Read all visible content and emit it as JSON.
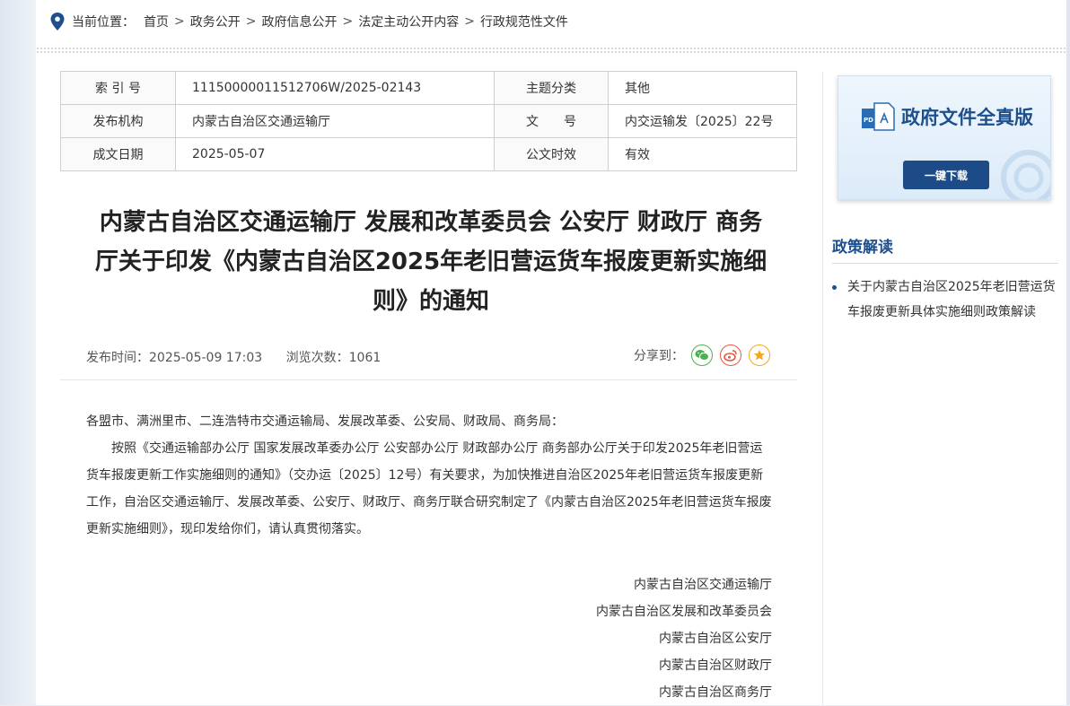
{
  "breadcrumb": {
    "prefix": "当前位置：",
    "items": [
      "首页",
      "政务公开",
      "政府信息公开",
      "法定主动公开内容",
      "行政规范性文件"
    ],
    "separator": ">"
  },
  "meta": {
    "index_label": "索 引 号",
    "index_value": "11150000011512706W/2025-02143",
    "topic_label": "主题分类",
    "topic_value": "其他",
    "org_label": "发布机构",
    "org_value": "内蒙古自治区交通运输厅",
    "docno_label": "文　　号",
    "docno_value": "内交运输发〔2025〕22号",
    "date_label": "成文日期",
    "date_value": "2025-05-07",
    "validity_label": "公文时效",
    "validity_value": "有效"
  },
  "title": {
    "line1": "内蒙古自治区交通运输厅 发展和改革委员会 公安厅 财政厅 商务",
    "line2": "厅关于印发《内蒙古自治区2025年老旧营运货车报废更新实施细",
    "line3": "则》的通知"
  },
  "pub": {
    "time": "发布时间：2025-05-09 17:03",
    "views": "浏览次数：1061",
    "share_label": "分享到："
  },
  "body": {
    "salutation": "各盟市、满洲里市、二连浩特市交通运输局、发展改革委、公安局、财政局、商务局：",
    "paragraph": "按照《交通运输部办公厅 国家发展改革委办公厅 公安部办公厅 财政部办公厅 商务部办公厅关于印发2025年老旧营运货车报废更新工作实施细则的通知》（交办运〔2025〕12号）有关要求，为加快推进自治区2025年老旧营运货车报废更新工作，自治区交通运输厅、发展改革委、公安厅、财政厅、商务厅联合研究制定了《内蒙古自治区2025年老旧营运货车报废更新实施细则》，现印发给你们，请认真贯彻落实。",
    "signatures": [
      "内蒙古自治区交通运输厅",
      "内蒙古自治区发展和改革委员会",
      "内蒙古自治区公安厅",
      "内蒙古自治区财政厅",
      "内蒙古自治区商务厅"
    ]
  },
  "sidebar": {
    "banner_title": "政府文件全真版",
    "banner_button": "一键下载",
    "section_title": "政策解读",
    "links": [
      "关于内蒙古自治区2025年老旧营运货车报废更新具体实施细则政策解读"
    ]
  },
  "colors": {
    "brand": "#1d4f8c",
    "button": "#1c4b87",
    "wechat": "#4caf50",
    "weibo": "#e8573c",
    "favorite": "#f2a81d"
  }
}
